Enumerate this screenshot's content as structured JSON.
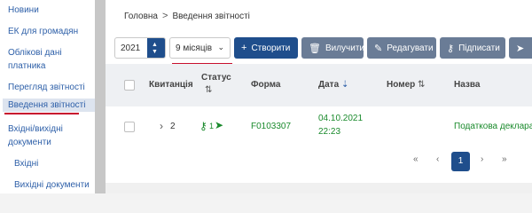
{
  "sidebar": {
    "items": [
      {
        "label": "Новини"
      },
      {
        "label": "ЕК для громадян"
      },
      {
        "label": "Облікові дані"
      },
      {
        "label": "платника"
      },
      {
        "label": "Перегляд звітності"
      },
      {
        "label": "Введення звітності"
      },
      {
        "label": "Вхідні/вихідні"
      },
      {
        "label": "документи"
      },
      {
        "label": "Вхідні"
      },
      {
        "label": "Вихідні документи"
      }
    ]
  },
  "breadcrumb": {
    "home": "Головна",
    "separator": ">",
    "current": "Введення звітності"
  },
  "toolbar": {
    "year": "2021",
    "month": "9 місяців",
    "buttons": {
      "create": "Створити",
      "delete": "Вилучити",
      "edit": "Редагувати",
      "sign": "Підписати"
    }
  },
  "table": {
    "headers": {
      "receipt": "Квитанція",
      "status_line1": "Статус",
      "form": "Форма",
      "date": "Дата",
      "number": "Номер",
      "name": "Назва"
    },
    "rows": [
      {
        "receipt": "2",
        "status_count": "1",
        "form": "F0103307",
        "date": "04.10.2021",
        "time": "22:23",
        "name": "Податкова декларація"
      }
    ]
  },
  "pagination": {
    "first": "«",
    "prev": "‹",
    "current": "1",
    "next": "›",
    "last": "»"
  },
  "colors": {
    "primary": "#1f4e8c",
    "accent_red": "#c8102e",
    "link": "#2d5fa8",
    "ok_green": "#1a8a2c"
  }
}
